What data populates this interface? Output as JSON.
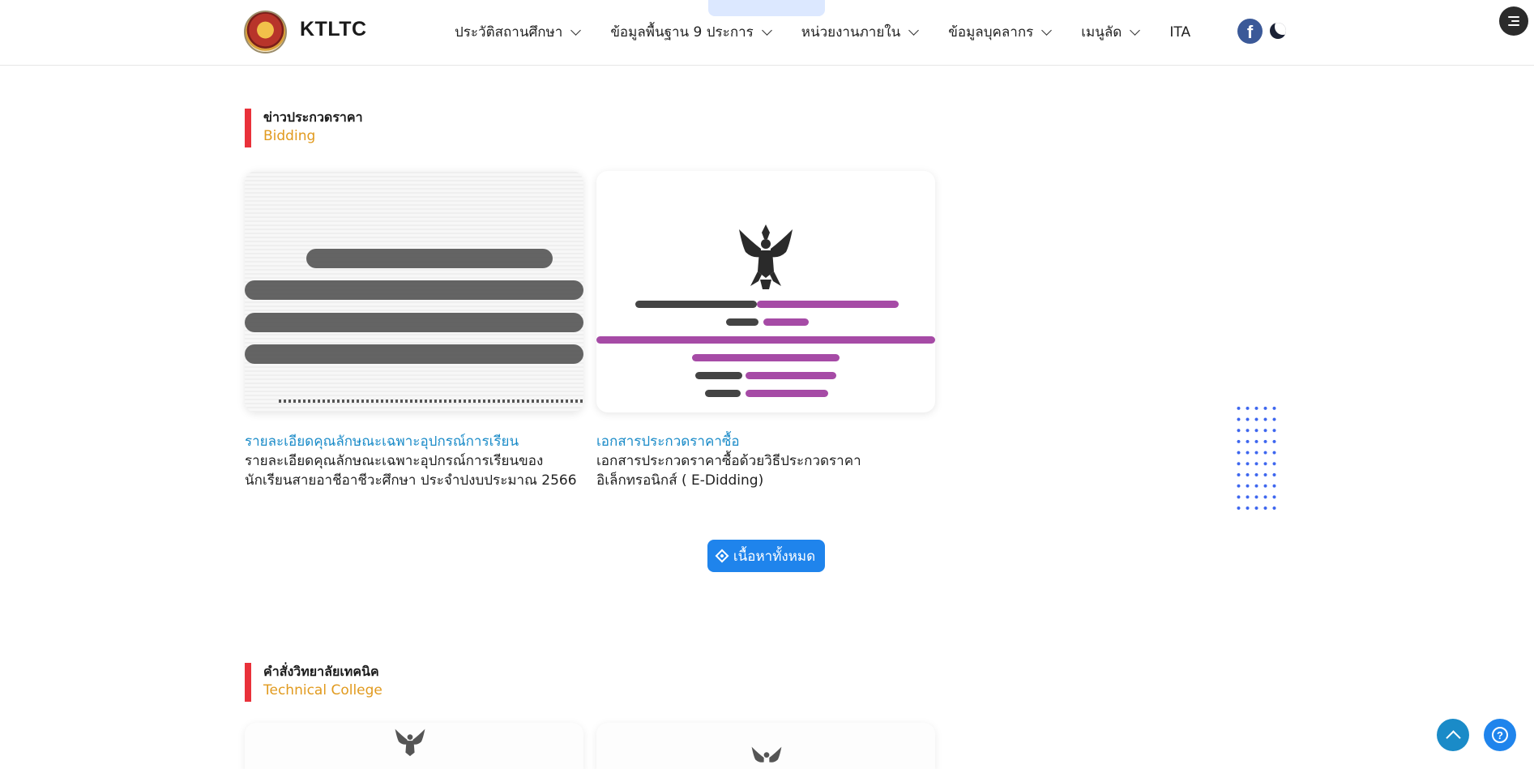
{
  "header": {
    "brand": "KTLTC",
    "nav": [
      {
        "label": "ประวัติสถานศึกษา",
        "has_dropdown": true
      },
      {
        "label": "ข้อมูลพื้นฐาน 9 ประการ",
        "has_dropdown": true
      },
      {
        "label": "หน่วยงานภายใน",
        "has_dropdown": true
      },
      {
        "label": "ข้อมูลบุคลากร",
        "has_dropdown": true
      },
      {
        "label": "เมนูลัด",
        "has_dropdown": true
      },
      {
        "label": "ITA",
        "has_dropdown": false
      }
    ],
    "facebook_glyph": "f",
    "icons": [
      "facebook-icon",
      "moon-icon",
      "menu-settings-icon"
    ]
  },
  "bidding": {
    "title": "ข่าวประกวดราคา",
    "subtitle": "Bidding",
    "cards": [
      {
        "title": "รายละเอียดคุณลักษณะเฉพาะอุปกรณ์การเรียน",
        "desc": "รายละเอียดคุณลักษณะเฉพาะอุปกรณ์การเรียนของนักเรียนสายอาชีอาชีวะศึกษา ประจำปงบประมาณ 2566"
      },
      {
        "title": "เอกสารประกวดราคาซื้อ",
        "desc": "เอกสารประกวดราคาซื้อด้วยวิธีประกวดราคาอิเล็กทรอนิกส์ ( E-Didding)"
      }
    ],
    "more_label": "เนื้อหาทั้งหมด"
  },
  "college": {
    "title": "คำสั่งวิทยาลัยเทคนิค",
    "subtitle": "Technical College"
  },
  "colors": {
    "accent_red": "#e9313a",
    "subtitle_orange": "#e19a1e",
    "link_blue": "#1a8bc8",
    "button_blue": "#1f84ec",
    "facebook_blue": "#3b5998"
  },
  "floating": {
    "help_glyph": "?"
  }
}
